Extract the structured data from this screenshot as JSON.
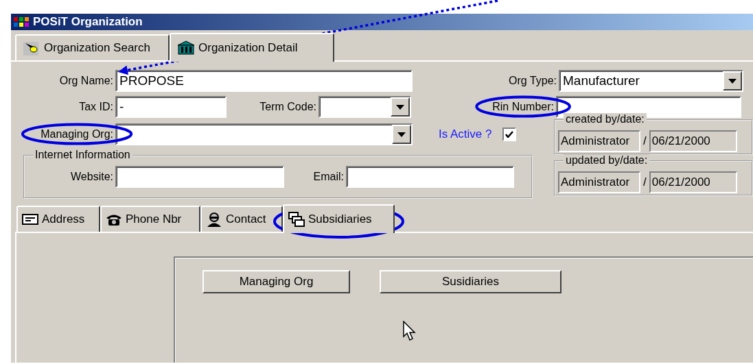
{
  "window": {
    "title": "POSiT Organization"
  },
  "tabs": [
    {
      "label": "Organization Search",
      "selected": false
    },
    {
      "label": "Organization Detail",
      "selected": true
    }
  ],
  "org_name": {
    "label": "Org Name:",
    "value": "PROPOSE",
    "circled": false,
    "pointed_at": true
  },
  "org_type": {
    "label": "Org Type:",
    "value": "Manufacturer",
    "circled": false
  },
  "tax_id": {
    "label": "Tax ID:",
    "value": "-",
    "circled": false
  },
  "term_code": {
    "label": "Term Code:",
    "circled": false
  },
  "rin_number": {
    "label": "Rin Number:",
    "circled": true
  },
  "managing_org": {
    "label": "Managing Org:",
    "circled": true
  },
  "is_active": {
    "label": "Is Active ?",
    "checked": true
  },
  "internet": {
    "legend": "Internet Information",
    "website_label": "Website:",
    "email_label": "Email:"
  },
  "created": {
    "legend": "created by/date:",
    "user": "Administrator",
    "separator": "/",
    "date": "06/21/2000"
  },
  "updated": {
    "legend": "updated by/date:",
    "user": "Administrator",
    "separator": "/",
    "date": "06/21/2000"
  },
  "subtabs": [
    {
      "label": "Address",
      "selected": false,
      "circled": false
    },
    {
      "label": "Phone Nbr",
      "selected": false,
      "circled": false
    },
    {
      "label": "Contact",
      "selected": false,
      "circled": false
    },
    {
      "label": "Subsidiaries",
      "selected": true,
      "circled": true
    }
  ],
  "buttons": [
    "Managing Org",
    "Susidiaries"
  ]
}
